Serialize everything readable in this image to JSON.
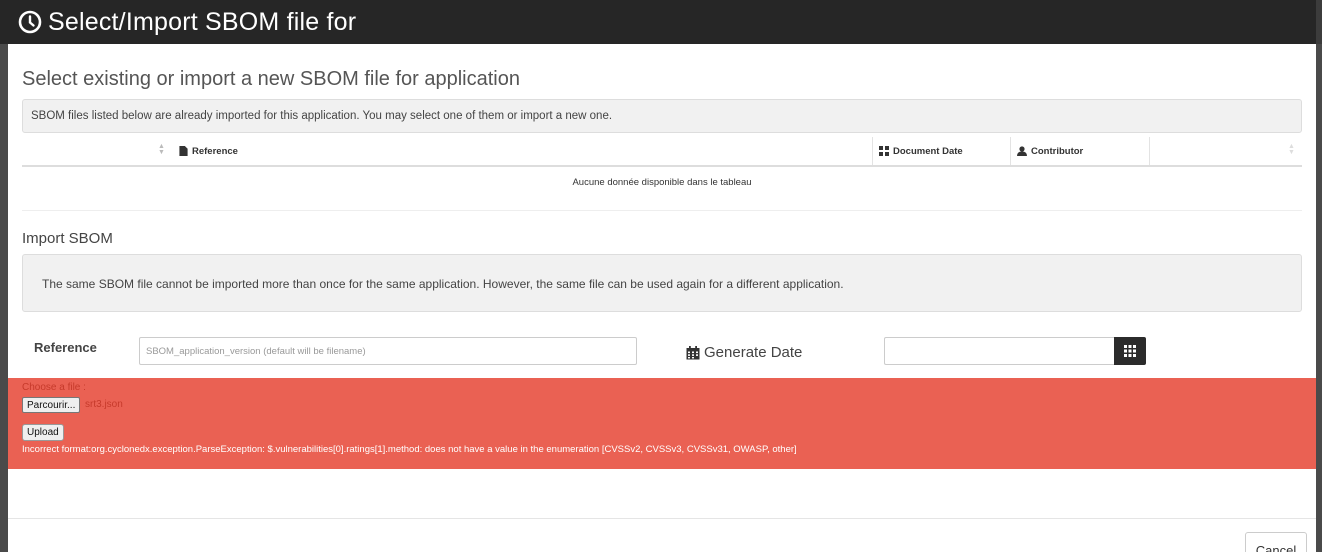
{
  "header": {
    "title": "Select/Import SBOM file for",
    "icon": "clock-icon"
  },
  "existing": {
    "title": "Select existing or import a new SBOM file for application",
    "info": "SBOM files listed below are already imported for this application. You may select one of them or import a new one.",
    "columns": {
      "reference": "Reference",
      "document_date": "Document Date",
      "contributor": "Contributor"
    },
    "empty_message": "Aucune donnée disponible dans le tableau"
  },
  "import": {
    "title": "Import SBOM",
    "note": "The same SBOM file cannot be imported more than once for the same application. However, the same file can be used again for a different application.",
    "reference_label": "Reference",
    "reference_placeholder": "SBOM_application_version (default will be filename)",
    "generate_date_label": "Generate Date",
    "generate_date_value": ""
  },
  "upload": {
    "choose_label": "Choose a file :",
    "browse_label": "Parcourir...",
    "file_name": "srt3.json",
    "upload_label": "Upload",
    "error_message": "Incorrect format:org.cyclonedx.exception.ParseException: $.vulnerabilities[0].ratings[1].method: does not have a value in the enumeration [CVSSv2, CVSSv3, CVSSv31, OWASP, other]",
    "error_color": "#ea6153"
  },
  "footer": {
    "cancel_label": "Cancel"
  }
}
